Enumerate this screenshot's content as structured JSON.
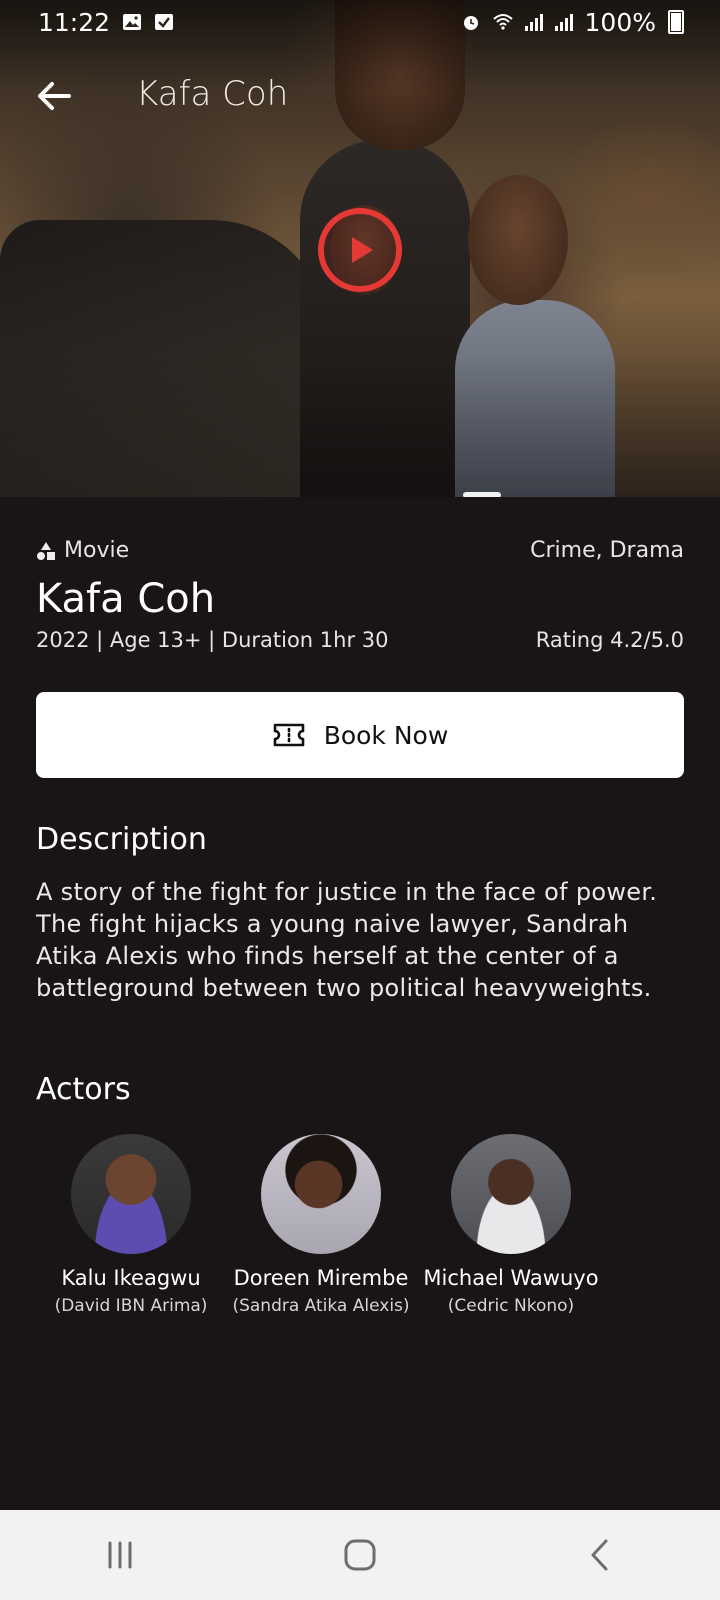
{
  "status_bar": {
    "time": "11:22",
    "battery": "100%"
  },
  "top_bar": {
    "title": "Kafa Coh"
  },
  "movie": {
    "type_label": "Movie",
    "genres": "Crime, Drama",
    "title": "Kafa Coh",
    "info": "2022 | Age 13+ | Duration 1hr 30",
    "rating": "Rating 4.2/5.0"
  },
  "book_button": {
    "label": "Book Now"
  },
  "description": {
    "heading": "Description",
    "text": "A story of the fight for justice in the face of power. The fight hijacks a young naive lawyer, Sandrah Atika Alexis who finds herself at the center of a battleground between two political heavyweights."
  },
  "actors": {
    "heading": "Actors",
    "items": [
      {
        "name": "Kalu Ikeagwu",
        "role": "(David IBN Arima)"
      },
      {
        "name": "Doreen Mirembe",
        "role": "(Sandra Atika Alexis)"
      },
      {
        "name": "Michael Wawuyo",
        "role": "(Cedric Nkono)"
      }
    ]
  },
  "colors": {
    "background": "#191516",
    "play_accent": "#e53935",
    "button_bg": "#ffffff",
    "nav_bg": "#f2f2f2"
  },
  "icons": {
    "back": "arrow-left-icon",
    "play": "play-icon",
    "movie_type": "shapes-icon",
    "ticket": "ticket-icon",
    "nav_recents": "recents-icon",
    "nav_home": "home-icon",
    "nav_back": "back-chevron-icon"
  }
}
